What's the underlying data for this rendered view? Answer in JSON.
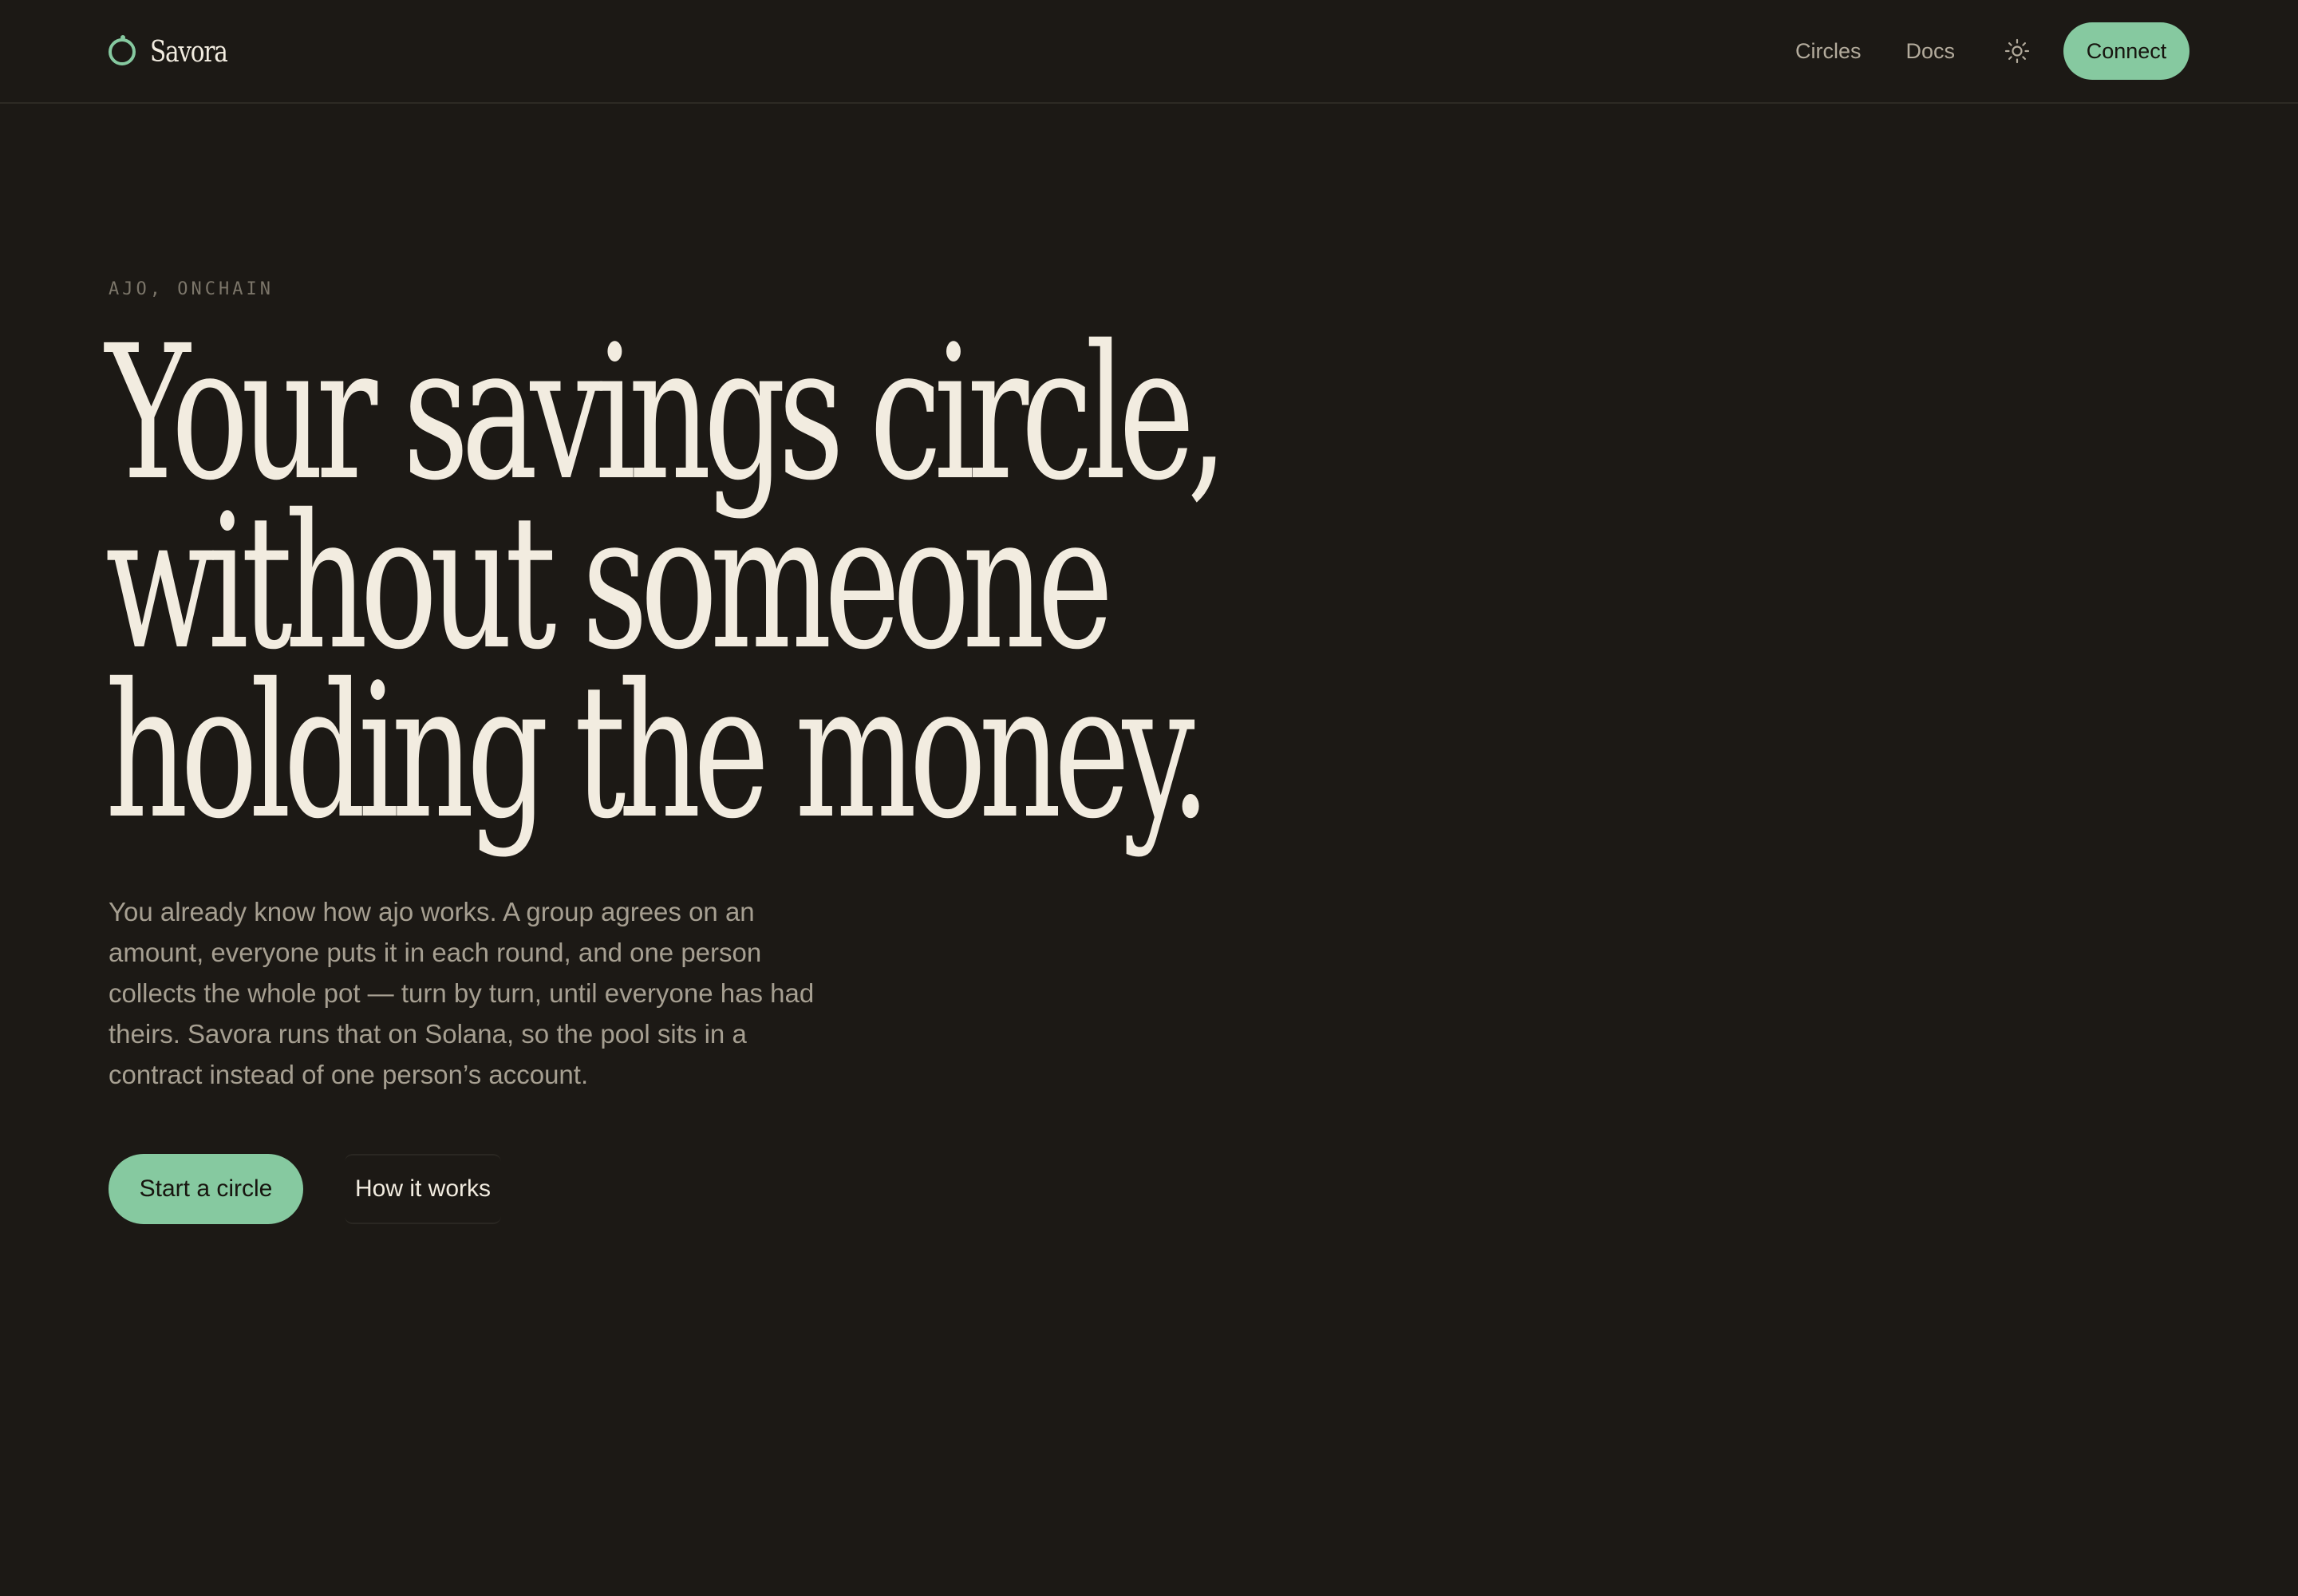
{
  "brand": {
    "name": "Savora"
  },
  "nav": {
    "links": [
      "Circles",
      "Docs"
    ],
    "connect_label": "Connect"
  },
  "hero": {
    "eyebrow": "AJO, ONCHAIN",
    "headline_lines": [
      "Your savings circle,",
      "without someone",
      "holding the money."
    ],
    "body": "You already know how ajo works. A group agrees on an amount, everyone puts it in each round, and one person collects the whole pot — turn by turn, until everyone has had theirs. Savora runs that on Solana, so the pool sits in a contract instead of one person’s account.",
    "primary_cta": "Start a circle",
    "secondary_cta": "How it works"
  },
  "icons": {
    "brand": "ring-logo-icon",
    "theme": "sun-icon"
  },
  "colors": {
    "background": "#1c1915",
    "accent": "#86c9a0",
    "heading": "#f2ece0",
    "body_text": "#a69f91",
    "muted": "#7b7569"
  }
}
